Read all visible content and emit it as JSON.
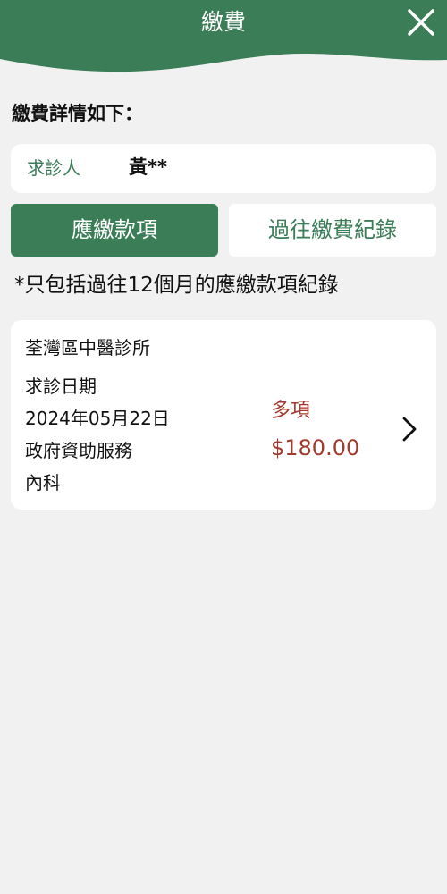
{
  "header": {
    "title": "繳費",
    "color": "#3b7d57"
  },
  "summary": {
    "heading": "繳費詳情如下："
  },
  "patient": {
    "label": "求診人",
    "name": "黃**"
  },
  "tabs": [
    {
      "label": "應繳款項",
      "active": true
    },
    {
      "label": "過往繳費紀錄",
      "active": false
    }
  ],
  "note": "*只包括過往12個月的應繳款項紀錄",
  "records": [
    {
      "clinic": "荃灣區中醫診所",
      "date_label": "求診日期",
      "date": "2024年05月22日",
      "service": "政府資助服務",
      "department": "內科",
      "items": "多項",
      "amount": "$180.00",
      "amount_color": "#a23a2e"
    }
  ],
  "icons": {
    "close": "close-icon",
    "chevron": "chevron-right-icon"
  }
}
